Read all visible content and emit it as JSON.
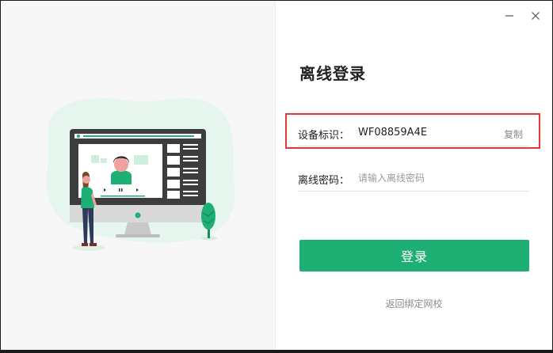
{
  "window": {
    "minimize_icon": "minimize-icon",
    "close_icon": "close-icon"
  },
  "login": {
    "title": "离线登录",
    "device_label": "设备标识：",
    "device_id": "WF08859A4E",
    "copy_label": "复制",
    "password_label": "离线密码：",
    "password_placeholder": "请输入离线密码",
    "submit_label": "登录",
    "back_link": "返回绑定网校"
  },
  "colors": {
    "accent": "#1daf74",
    "highlight_border": "#e53935",
    "illustration_blob": "#e6f5ee"
  }
}
